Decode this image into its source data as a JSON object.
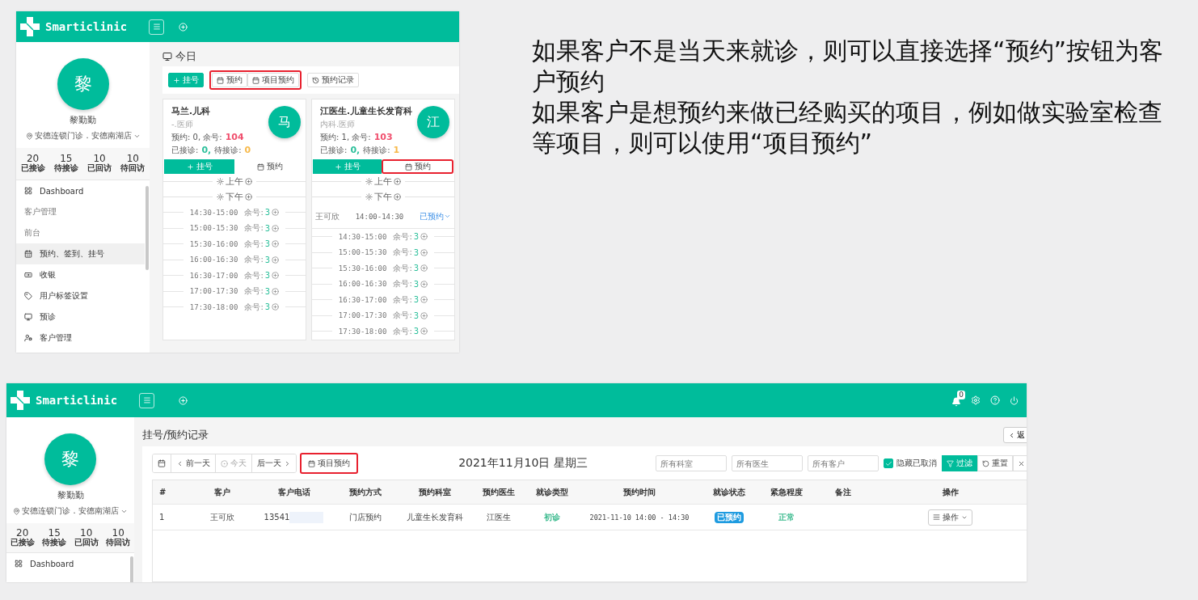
{
  "slide_text": [
    "如果客户不是当天来就诊，则可以直接选择“预约”按钮为客户预约",
    "如果客户是想预约来做已经购买的项目，例如做实验室检查等项目，则可以使用“项目预约”"
  ],
  "screenshot_today": {
    "header": {
      "brand": "Smarticlinic"
    },
    "profile": {
      "avatar": "黎",
      "name": "黎勤勤",
      "location": "安德连锁门诊．安德南湖店"
    },
    "stats": [
      {
        "value": "20",
        "label": "已接诊"
      },
      {
        "value": "15",
        "label": "待接诊"
      },
      {
        "value": "10",
        "label": "已回访"
      },
      {
        "value": "10",
        "label": "待回访"
      }
    ],
    "sidebar": {
      "items": [
        {
          "kind": "link",
          "label": "Dashboard",
          "selected": false
        },
        {
          "kind": "section",
          "label": "客户管理"
        },
        {
          "kind": "section",
          "label": "前台"
        },
        {
          "kind": "link",
          "label": "预约、签到、挂号",
          "selected": true
        },
        {
          "kind": "link",
          "label": "收银",
          "selected": false
        },
        {
          "kind": "link",
          "label": "用户标签设置",
          "selected": false
        },
        {
          "kind": "link",
          "label": "预诊",
          "selected": false
        },
        {
          "kind": "link",
          "label": "客户管理",
          "selected": false
        }
      ]
    },
    "page_title": "今日",
    "toolbar": [
      {
        "highlighted": false,
        "buttons": [
          {
            "kind": "register",
            "label": "挂号"
          }
        ]
      },
      {
        "highlighted": true,
        "buttons": [
          {
            "kind": "book",
            "label": "预约"
          },
          {
            "kind": "book",
            "label": "项目预约"
          }
        ]
      },
      {
        "highlighted": false,
        "buttons": [
          {
            "kind": "history",
            "label": "预约记录"
          }
        ]
      }
    ],
    "cards": [
      {
        "doctor": "马兰.儿科",
        "title": "-.医师",
        "avatar": "马",
        "lines": [
          [
            {
              "text": "预约:  0, 余号:"
            },
            {
              "text": "104",
              "color": "#f0506e"
            }
          ],
          [
            {
              "text": "已接诊:"
            },
            {
              "text": "0,",
              "color": "#2bbf9a"
            },
            {
              "text": "待接诊:"
            },
            {
              "text": "0",
              "color": "#f7b94a"
            }
          ]
        ],
        "actions": [
          {
            "kind": "register",
            "label": "挂号",
            "highlighted": false
          },
          {
            "kind": "book",
            "label": "预约",
            "highlighted": false
          }
        ],
        "periods": [
          {
            "label": "上午"
          },
          {
            "label": "下午",
            "slots": [
              {
                "time": "14:30-15:00",
                "remaining_label": "余号:",
                "remaining": "3"
              },
              {
                "time": "15:00-15:30",
                "remaining_label": "余号:",
                "remaining": "3"
              },
              {
                "time": "15:30-16:00",
                "remaining_label": "余号:",
                "remaining": "3"
              },
              {
                "time": "16:00-16:30",
                "remaining_label": "余号:",
                "remaining": "3"
              },
              {
                "time": "16:30-17:00",
                "remaining_label": "余号:",
                "remaining": "3"
              },
              {
                "time": "17:00-17:30",
                "remaining_label": "余号:",
                "remaining": "3"
              },
              {
                "time": "17:30-18:00",
                "remaining_label": "余号:",
                "remaining": "3"
              }
            ]
          }
        ]
      },
      {
        "doctor": "江医生.儿童生长发育科",
        "title": "内科.医师",
        "avatar": "江",
        "lines": [
          [
            {
              "text": "预约:  1, 余号:"
            },
            {
              "text": "103",
              "color": "#f0506e"
            }
          ],
          [
            {
              "text": "已接诊:"
            },
            {
              "text": "0,",
              "color": "#2bbf9a"
            },
            {
              "text": "待接诊:"
            },
            {
              "text": "1",
              "color": "#f7b94a"
            }
          ]
        ],
        "actions": [
          {
            "kind": "register",
            "label": "挂号",
            "highlighted": false
          },
          {
            "kind": "book",
            "label": "预约",
            "highlighted": true
          }
        ],
        "periods": [
          {
            "label": "上午"
          },
          {
            "label": "下午",
            "appointments": [
              {
                "patient": "王可欣",
                "time": "14:00-14:30",
                "status": "已预约"
              }
            ],
            "slots": [
              {
                "time": "14:30-15:00",
                "remaining_label": "余号:",
                "remaining": "3"
              },
              {
                "time": "15:00-15:30",
                "remaining_label": "余号:",
                "remaining": "3"
              },
              {
                "time": "15:30-16:00",
                "remaining_label": "余号:",
                "remaining": "3"
              },
              {
                "time": "16:00-16:30",
                "remaining_label": "余号:",
                "remaining": "3"
              },
              {
                "time": "16:30-17:00",
                "remaining_label": "余号:",
                "remaining": "3"
              },
              {
                "time": "17:00-17:30",
                "remaining_label": "余号:",
                "remaining": "3"
              },
              {
                "time": "17:30-18:00",
                "remaining_label": "余号:",
                "remaining": "3"
              }
            ]
          }
        ]
      }
    ]
  },
  "screenshot_records": {
    "header": {
      "brand": "Smarticlinic",
      "notifications": "0"
    },
    "profile": {
      "avatar": "黎",
      "name": "黎勤勤",
      "location": "安德连锁门诊．安德南湖店"
    },
    "stats": [
      {
        "value": "20",
        "label": "已接诊"
      },
      {
        "value": "15",
        "label": "待接诊"
      },
      {
        "value": "10",
        "label": "已回访"
      },
      {
        "value": "10",
        "label": "待回访"
      }
    ],
    "sidebar": {
      "items": [
        {
          "kind": "link",
          "label": "Dashboard",
          "selected": false
        }
      ]
    },
    "page_title": "挂号/预约记录",
    "back_button": "返",
    "date_nav": [
      {
        "kind": "calendar"
      },
      {
        "kind": "prev",
        "label": "前一天",
        "disabled": false
      },
      {
        "kind": "today",
        "label": "今天",
        "disabled": true
      },
      {
        "kind": "next",
        "label": "后一天",
        "disabled": false
      }
    ],
    "project_button": {
      "label": "项目预约",
      "highlighted": true
    },
    "date_title": "2021年11月10日 星期三",
    "filters": [
      {
        "placeholder": "所有科室"
      },
      {
        "placeholder": "所有医生"
      },
      {
        "placeholder": "所有客户"
      }
    ],
    "hide_cancelled": {
      "label": "隐藏已取消",
      "checked": true
    },
    "filter_buttons": [
      {
        "kind": "filter",
        "label": "过滤"
      },
      {
        "kind": "reset",
        "label": "重置"
      },
      {
        "kind": "clear"
      }
    ],
    "table": {
      "columns": [
        "#",
        "客户",
        "客户电话",
        "预约方式",
        "预约科室",
        "预约医生",
        "就诊类型",
        "预约时间",
        "就诊状态",
        "紧急程度",
        "备注",
        "操作"
      ],
      "rows": [
        {
          "cells": [
            {
              "kind": "text",
              "text": "1"
            },
            {
              "kind": "text",
              "text": "王可欣"
            },
            {
              "kind": "masked",
              "text": "13541"
            },
            {
              "kind": "text",
              "text": "门店预约"
            },
            {
              "kind": "text",
              "text": "儿童生长发育科"
            },
            {
              "kind": "text",
              "text": "江医生"
            },
            {
              "kind": "text",
              "text": "初诊",
              "color": "#3dbb8f"
            },
            {
              "kind": "mono",
              "text": "2021-11-10 14:00 - 14:30"
            },
            {
              "kind": "badge",
              "text": "已预约"
            },
            {
              "kind": "text",
              "text": "正常",
              "color": "#3dbb8f"
            },
            {
              "kind": "blank"
            },
            {
              "kind": "menu",
              "text": "操作"
            }
          ]
        }
      ]
    }
  }
}
